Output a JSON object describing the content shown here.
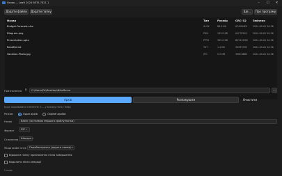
{
  "window": {
    "title": "Назва — Leaft 2024 BETA 7821.1",
    "controls": {
      "minimize": "–",
      "maximize": "☐",
      "close": "✕"
    }
  },
  "toolbar": {
    "add_files": "Додати файли",
    "add_folder": "Додати папку",
    "more": "Ще...",
    "about": "Про програму"
  },
  "table": {
    "columns": [
      "Назва",
      "Тип",
      "Розмір",
      "CRC-32",
      "Змінено"
    ],
    "rows": [
      {
        "name": "Budget-Forecast.xlsx",
        "type": "XLSX",
        "size": "88.0 KB",
        "crc": "A7A904E9",
        "modified": "2024-09-01 20:36"
      },
      {
        "name": "Diagram.png",
        "type": "PNG",
        "size": "135.0 KB",
        "crc": "A1F7E903",
        "modified": "2024-09-01 20:36"
      },
      {
        "name": "Presentation.pptx",
        "type": "PPTX",
        "size": "395.0 KB",
        "crc": "B251CD9B",
        "modified": "2024-09-01 20:36"
      },
      {
        "name": "ReadMe.txt",
        "type": "TXT",
        "size": "1.4 KB",
        "crc": "3D3F5593",
        "modified": "2024-09-01 20:36"
      },
      {
        "name": "Vacation-Photo.jpg",
        "type": "JPG",
        "size": "5.2 MB",
        "crc": "39BC8B83",
        "modified": "2024-09-01 20:36"
      }
    ]
  },
  "dest": {
    "label": "Призначення",
    "value": "C:\\Users\\Po\\Desktop\\NikoDemo",
    "browse": "..."
  },
  "actions": {
    "archive": "Архів",
    "extract": "Розпакувати",
    "clear": "Очистити"
  },
  "hint": "Буде заархівовано елементів: 5 — у вихідну папку Tabby",
  "mode": {
    "label": "Режим",
    "option_single": "Один архів",
    "option_separate": "Окремі архіви",
    "selected": "single"
  },
  "name": {
    "label": "Назва",
    "value": "Batch (за назвою першого файлу/папки)"
  },
  "format": {
    "label": "Формат",
    "value": "ZIP"
  },
  "compression": {
    "label": "Стиснення",
    "value": "Швидко"
  },
  "when_exists": {
    "label": "Якщо файл існує",
    "value": "Перейменувати (додати номер)"
  },
  "options": {
    "open_folder": "Відкрити папку призначення після завершення",
    "delete_after": "Видалити після операції"
  },
  "status": "Готово"
}
